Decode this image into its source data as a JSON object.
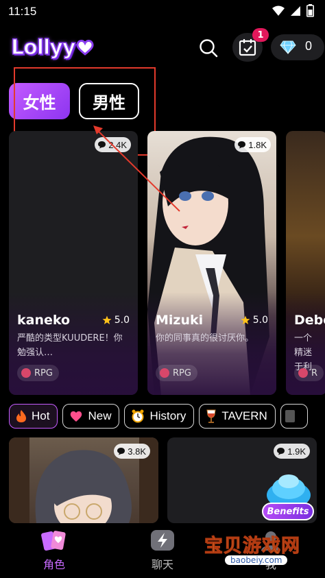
{
  "status_bar": {
    "time": "11:15",
    "icons": [
      "wifi-icon",
      "signal-icon",
      "battery-icon"
    ]
  },
  "header": {
    "logo_text": "Lollyy",
    "checkin_badge": "1",
    "gem_count": "0",
    "icons": [
      "search-icon",
      "calendar-check-icon",
      "diamond-icon"
    ]
  },
  "gender_tabs": [
    {
      "label": "女性",
      "active": true
    },
    {
      "label": "男性",
      "active": false
    }
  ],
  "featured_cards": [
    {
      "count": "2.4K",
      "name": "kaneko",
      "rating": "5.0",
      "desc": "严酷的类型KUUDERE！你勉强认…",
      "tag": "RPG"
    },
    {
      "count": "1.8K",
      "name": "Mizuki",
      "rating": "5.0",
      "desc": "你的同事真的很讨厌你。",
      "tag": "RPG"
    },
    {
      "count": "",
      "name": "Debo",
      "rating": "",
      "desc": "一个精迷于利",
      "tag": "R"
    }
  ],
  "category_chips": [
    {
      "label": "Hot",
      "icon": "fire-icon",
      "active": true
    },
    {
      "label": "New",
      "icon": "heart-icon",
      "active": false
    },
    {
      "label": "History",
      "icon": "alarm-clock-icon",
      "active": false
    },
    {
      "label": "TAVERN",
      "icon": "wine-glass-icon",
      "active": false
    }
  ],
  "grid_cards": [
    {
      "count": "3.8K"
    },
    {
      "count": "1.9K"
    }
  ],
  "benefits_label": "Benefits",
  "bottom_nav": [
    {
      "label": "角色",
      "icon": "cards-icon",
      "active": true
    },
    {
      "label": "聊天",
      "icon": "chat-bolt-icon",
      "active": false
    },
    {
      "label": "我",
      "icon": "profile-icon",
      "active": false
    }
  ],
  "watermark": {
    "text": "宝贝游戏网",
    "url": "baobeiy.com"
  },
  "colors": {
    "accent": "#a54cf5",
    "badge": "#e2185b",
    "annotation": "#e33a2c",
    "background": "#000000"
  }
}
